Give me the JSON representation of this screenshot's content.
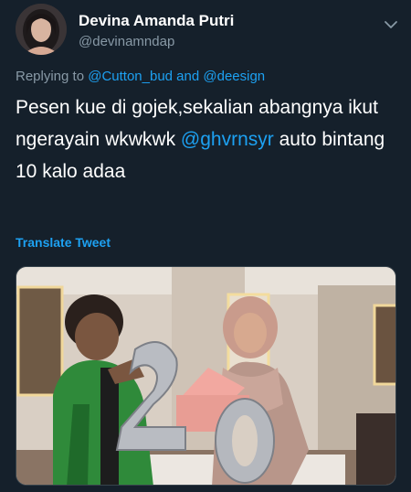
{
  "user": {
    "display_name": "Devina Amanda Putri",
    "handle": "@devinamndap"
  },
  "reply": {
    "prefix": "Replying to",
    "mentions": "@Cutton_bud and @deesign"
  },
  "tweet": {
    "text_part1": "Pesen kue di gojek,sekalian abangnya ikut ngerayain wkwkwk",
    "mention": "@ghvrnsyr",
    "text_part2": "auto bintang 10 kalo adaa",
    "translate_label": "Translate Tweet"
  },
  "icons": {
    "caret": "chevron-down-icon"
  },
  "colors": {
    "background": "#15202b",
    "link": "#1da1f2",
    "secondary_text": "#8899a6",
    "primary_text": "#ffffff"
  }
}
